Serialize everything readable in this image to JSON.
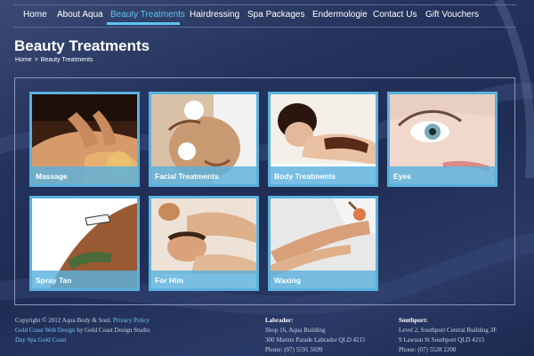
{
  "nav": {
    "items": [
      {
        "label": "Home"
      },
      {
        "label": "About Aqua"
      },
      {
        "label": "Beauty Treatments"
      },
      {
        "label": "Hairdressing"
      },
      {
        "label": "Spa Packages"
      },
      {
        "label": "Endermologie"
      },
      {
        "label": "Contact Us"
      },
      {
        "label": "Gift Vouchers"
      }
    ],
    "active": "Beauty Treatments"
  },
  "page": {
    "title": "Beauty Treatments",
    "breadcrumb": {
      "home": "Home",
      "separator": ">",
      "current": "Beauty Treatments"
    }
  },
  "tiles": [
    {
      "label": "Massage",
      "image": "massage-photo"
    },
    {
      "label": "Facial Treatments",
      "image": "facial-photo"
    },
    {
      "label": "Body Treatments",
      "image": "body-treatment-photo"
    },
    {
      "label": "Eyes",
      "image": "eye-closeup-photo"
    },
    {
      "label": "Spray Tan",
      "image": "spray-tan-photo"
    },
    {
      "label": "For Him",
      "image": "men-massage-photo"
    },
    {
      "label": "Waxing",
      "image": "waxing-photo"
    }
  ],
  "footer": {
    "copyright": "Copyright © 2012 Aqua Body & Soul.",
    "privacy": "Privacy Policy",
    "web_design_link": "Gold Coast Web Design",
    "web_design_by": "by Gold Coast Design Studio",
    "day_spa": "Day Spa Gold Coast",
    "labrador": {
      "heading": "Labrador:",
      "line1": "Shop 16, Aqua Building",
      "line2": "300 Marine Parade Labrador QLD 4215",
      "phone": "Phone: (07) 5591 5699"
    },
    "southport": {
      "heading": "Southport:",
      "line1": "Level 2, Southport Central Building 3F",
      "line2": "9 Lawson St Southport QLD 4215",
      "phone": "Phone: (07) 5528 2200"
    }
  },
  "colors": {
    "accent": "#5fc4f0",
    "tile_border": "#5ab1dd",
    "background": "#24335c"
  }
}
